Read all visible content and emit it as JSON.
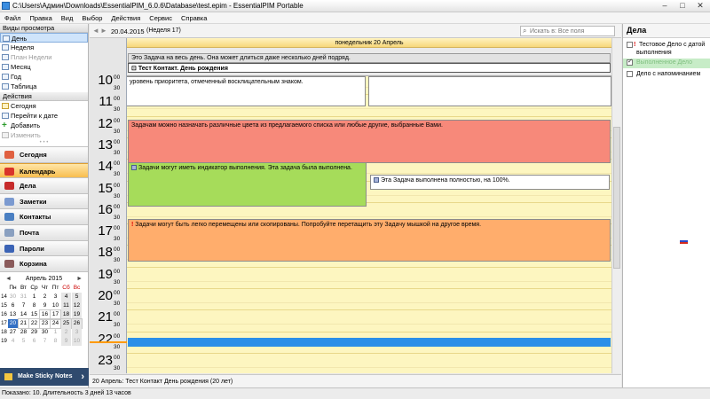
{
  "window": {
    "title": "C:\\Users\\Админ\\Downloads\\EssentialPIM_6.0.6\\Database\\test.epim - EssentialPIM Portable",
    "minimize": "–",
    "maximize": "□",
    "close": "✕"
  },
  "menu": [
    "Файл",
    "Правка",
    "Вид",
    "Выбор",
    "Действия",
    "Сервис",
    "Справка"
  ],
  "views": {
    "header": "Виды просмотра",
    "items": [
      {
        "label": "День",
        "icon": "day-view-icon"
      },
      {
        "label": "Неделя",
        "icon": "week-view-icon"
      },
      {
        "label": "План Недели",
        "icon": "week-plan-icon"
      },
      {
        "label": "Месяц",
        "icon": "month-view-icon"
      },
      {
        "label": "Год",
        "icon": "year-view-icon"
      },
      {
        "label": "Таблица",
        "icon": "table-view-icon"
      }
    ]
  },
  "actions": {
    "header": "Действия",
    "items": [
      {
        "label": "Сегодня",
        "icon": "today-icon"
      },
      {
        "label": "Перейти к дате",
        "icon": "goto-date-icon"
      },
      {
        "label": "Добавить",
        "icon": "add-icon"
      },
      {
        "label": "Изменить",
        "icon": "edit-icon"
      }
    ]
  },
  "nav": [
    {
      "label": "Сегодня",
      "color": "#e06040"
    },
    {
      "label": "Календарь",
      "color": "#d9342b"
    },
    {
      "label": "Дела",
      "color": "#c62b2b"
    },
    {
      "label": "Заметки",
      "color": "#7b9ad0"
    },
    {
      "label": "Контакты",
      "color": "#4a7fc2"
    },
    {
      "label": "Почта",
      "color": "#8aa0c0"
    },
    {
      "label": "Пароли",
      "color": "#3b63b5"
    },
    {
      "label": "Корзина",
      "color": "#8a5a5a"
    }
  ],
  "minical": {
    "title": "Апрель  2015",
    "prev": "◄",
    "next": "►",
    "weekdays": [
      "Пн",
      "Вт",
      "Ср",
      "Чт",
      "Пт",
      "Сб",
      "Вс"
    ],
    "weeks": [
      "14",
      "15",
      "16",
      "17",
      "18",
      "19"
    ],
    "days": [
      "30",
      "31",
      "1",
      "2",
      "3",
      "4",
      "5",
      "6",
      "7",
      "8",
      "9",
      "10",
      "11",
      "12",
      "13",
      "14",
      "15",
      "16",
      "17",
      "18",
      "19",
      "20",
      "21",
      "22",
      "23",
      "24",
      "25",
      "26",
      "27",
      "28",
      "29",
      "30",
      "1",
      "2",
      "3",
      "4",
      "5",
      "6",
      "7",
      "8",
      "9",
      "10"
    ]
  },
  "sticky": "Make Sticky Notes",
  "toolbar": {
    "date": "20.04.2015",
    "week": "(Неделя 17)",
    "search_placeholder": "Искать в: Все поля"
  },
  "day_header": "понедельник 20 Апрель",
  "allday": {
    "task": "Это Задача на весь день. Она может длиться даже несколько дней подряд.",
    "contact": "Тест Контакт. День рождения"
  },
  "hours": [
    "10",
    "11",
    "12",
    "13",
    "14",
    "15",
    "16",
    "17",
    "18",
    "19",
    "20",
    "21",
    "22",
    "23"
  ],
  "min00": "00",
  "min30": "30",
  "tasks": {
    "priority": "уровень приоритета, отмеченный восклицательным знаком.",
    "colors": "Задачам можно назначать различные цвета из предлагаемого списка или любые другие, выбранные Вами.",
    "progress": "Задачи могут иметь индикатор выполнения. Эта задача была выполнена.",
    "completed": "Эта Задача выполнена полностью, на 100%.",
    "move": "Задачи могут быть легко перемещены или скопированы. Попробуйте перетащить эту Задачу мышкой на другое время.",
    "progress_level": 1.0
  },
  "colors": {
    "red_task": "#f7897a",
    "green_task": "#a6dc5a",
    "orange_task": "#ffad6c",
    "blue_bar": "#2b8fe8",
    "now_line": "#ff9a00",
    "completed_muted": "#7fbf7f"
  },
  "todo": {
    "header": "Дела",
    "items": [
      {
        "label": "Тестовое Дело с датой выполнения",
        "priority": "!",
        "checked": false
      },
      {
        "label": "Выполненное Дело",
        "priority": "",
        "checked": true
      },
      {
        "label": "Дело с напоминанием",
        "priority": "",
        "checked": false
      }
    ]
  },
  "bottom_info": "20 Апрель:  Тест Контакт День рождения  (20 лет)",
  "status": "Показано: 10. Длительность 3 дней 13 часов"
}
